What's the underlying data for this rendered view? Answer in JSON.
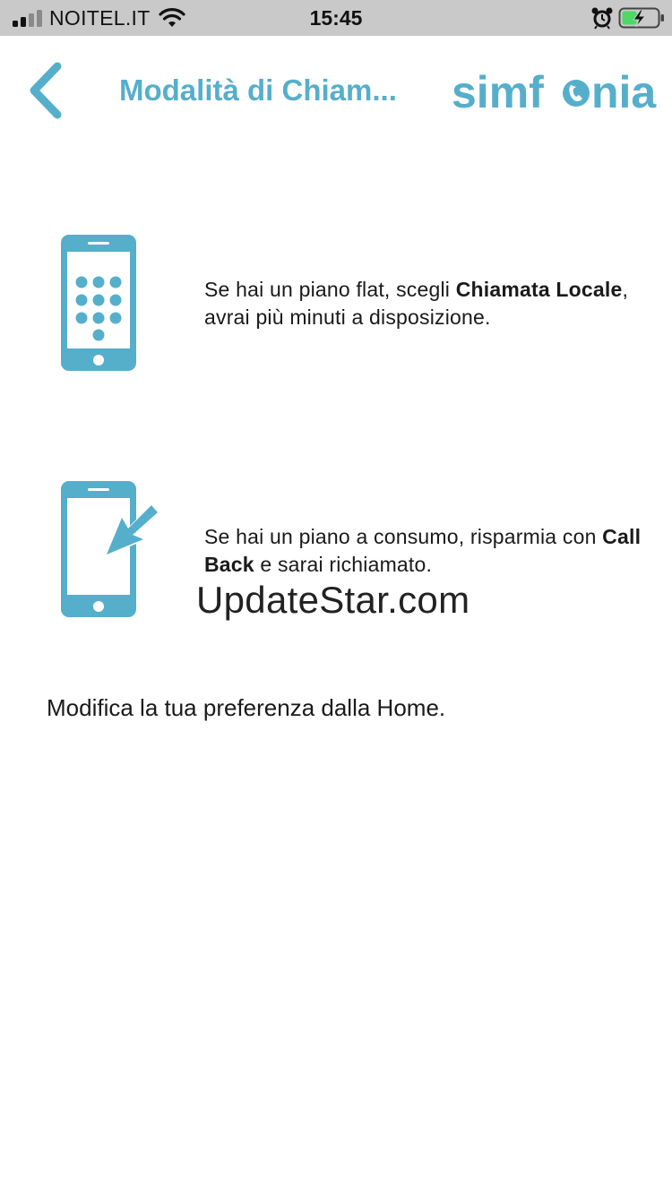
{
  "status_bar": {
    "carrier": "NOITEL.IT",
    "time": "15:45",
    "icons": [
      "signal-icon",
      "wifi-icon",
      "alarm-icon",
      "battery-charging-icon"
    ]
  },
  "header": {
    "back_icon": "chevron-left-icon",
    "title": "Modalità di Chiam...",
    "brand_left": "simf",
    "brand_right": "nia"
  },
  "options": [
    {
      "icon": "phone-keypad-icon",
      "text_before": "Se hai un piano flat, scegli ",
      "text_bold": "Chiamata Locale",
      "text_after": ", avrai più minuti a disposizione."
    },
    {
      "icon": "phone-callback-icon",
      "text_before": "Se hai un piano a consumo, risparmia con ",
      "text_bold": "Call Back",
      "text_after": " e sarai richiamato."
    }
  ],
  "watermark": "UpdateStar.com",
  "footer_note": "Modifica la tua preferenza dalla Home.",
  "colors": {
    "accent": "#55afcb",
    "status_bar_bg": "#c9c9c9",
    "battery_green": "#4cd964"
  }
}
